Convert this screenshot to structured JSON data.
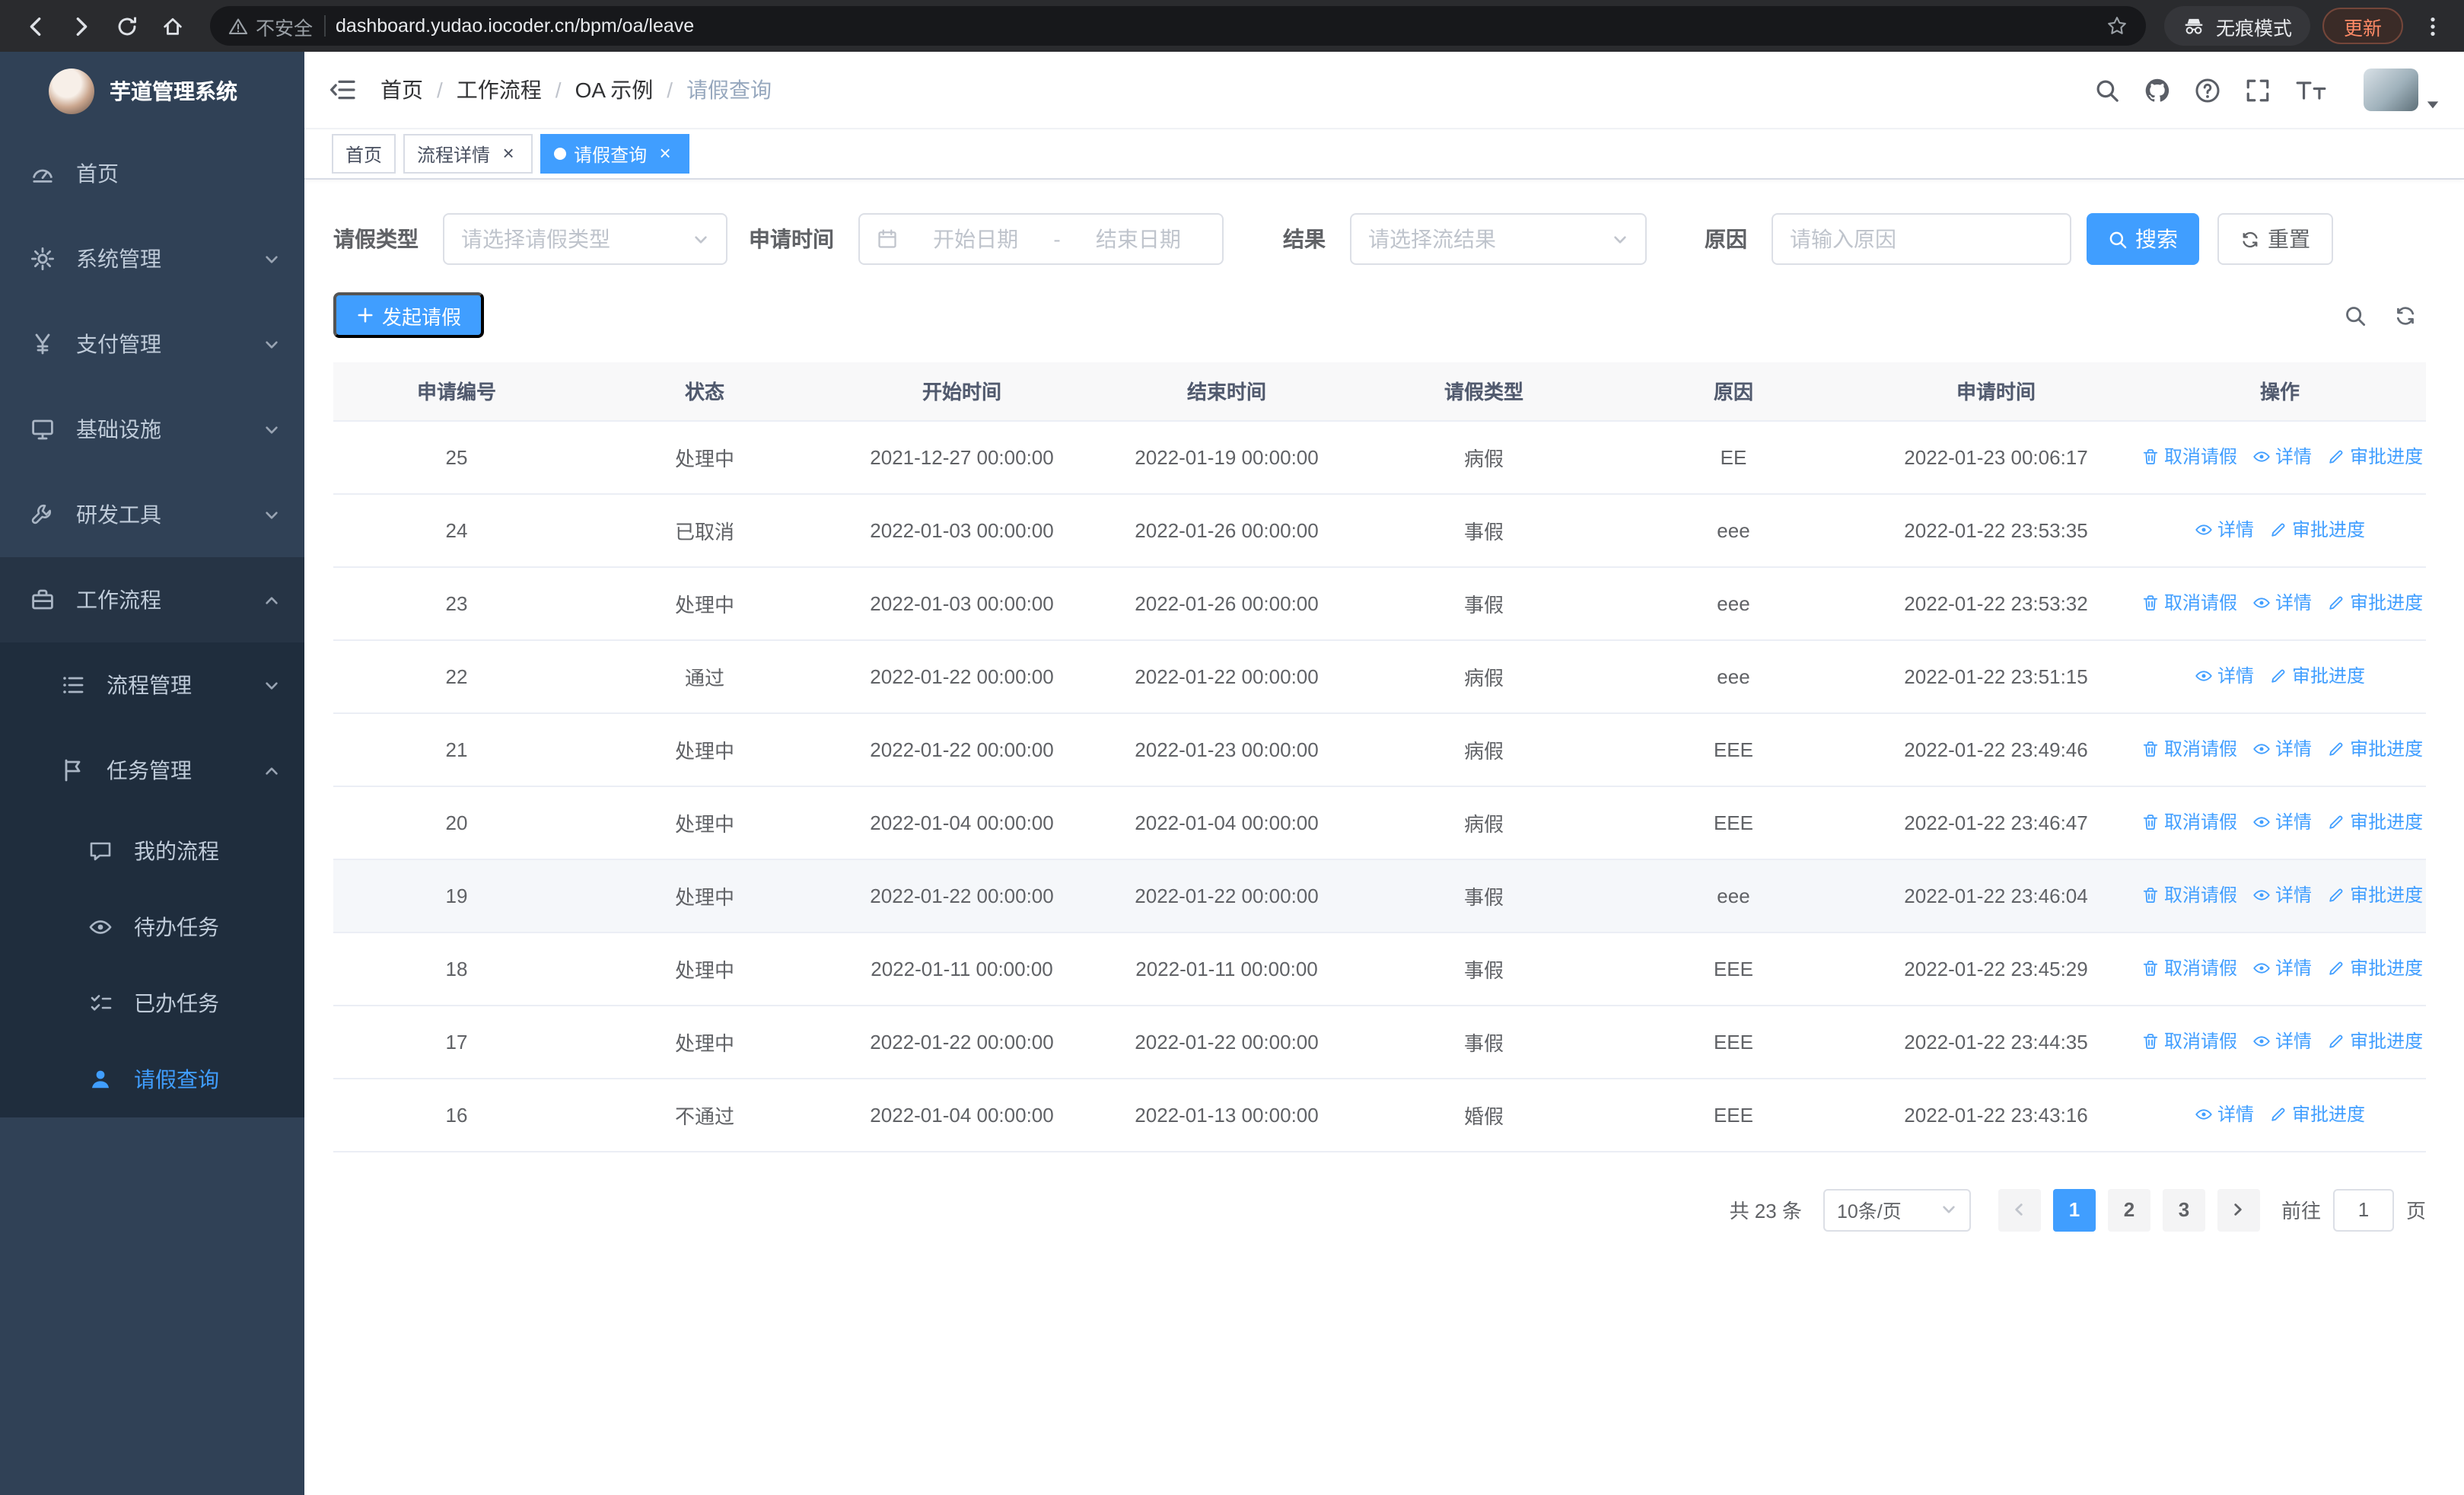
{
  "colors": {
    "primary": "#409eff",
    "sidebar_bg": "#304156",
    "sidebar_submenu_bg": "#1f2d3d"
  },
  "browser": {
    "security_label": "不安全",
    "url": "dashboard.yudao.iocoder.cn/bpm/oa/leave",
    "incognito_label": "无痕模式",
    "update_label": "更新"
  },
  "sidebar": {
    "app_title": "芋道管理系统",
    "menu": [
      {
        "key": "home",
        "label": "首页",
        "icon": "gauge",
        "level": 1
      },
      {
        "key": "system",
        "label": "系统管理",
        "icon": "gear",
        "level": 1,
        "chevron": "down"
      },
      {
        "key": "payment",
        "label": "支付管理",
        "icon": "yen",
        "level": 1,
        "chevron": "down"
      },
      {
        "key": "infrastructure",
        "label": "基础设施",
        "icon": "monitor",
        "level": 1,
        "chevron": "down"
      },
      {
        "key": "dev-tools",
        "label": "研发工具",
        "icon": "wrench",
        "level": 1,
        "chevron": "down"
      },
      {
        "key": "workflow",
        "label": "工作流程",
        "icon": "briefcase",
        "level": 1,
        "chevron": "up",
        "open": true
      },
      {
        "key": "process-management",
        "label": "流程管理",
        "icon": "list",
        "level": 2,
        "chevron": "down",
        "sub": true
      },
      {
        "key": "task-management",
        "label": "任务管理",
        "icon": "flag",
        "level": 2,
        "chevron": "up",
        "sub": true
      },
      {
        "key": "my-process",
        "label": "我的流程",
        "icon": "chat",
        "level": 3,
        "sub": true
      },
      {
        "key": "todo-tasks",
        "label": "待办任务",
        "icon": "eye",
        "level": 3,
        "sub": true
      },
      {
        "key": "done-tasks",
        "label": "已办任务",
        "icon": "check-list",
        "level": 3,
        "sub": true
      },
      {
        "key": "leave-query",
        "label": "请假查询",
        "icon": "user",
        "level": 3,
        "sub": true,
        "active": true
      }
    ]
  },
  "header": {
    "breadcrumb": [
      "首页",
      "工作流程",
      "OA 示例",
      "请假查询"
    ]
  },
  "tabs": [
    {
      "key": "home",
      "label": "首页",
      "closable": false,
      "active": false
    },
    {
      "key": "process-detail",
      "label": "流程详情",
      "closable": true,
      "active": false
    },
    {
      "key": "leave-query",
      "label": "请假查询",
      "closable": true,
      "active": true
    }
  ],
  "filters": {
    "leave_type_label": "请假类型",
    "leave_type_placeholder": "请选择请假类型",
    "apply_time_label": "申请时间",
    "start_date_placeholder": "开始日期",
    "range_separator": "-",
    "end_date_placeholder": "结束日期",
    "result_label": "结果",
    "result_placeholder": "请选择流结果",
    "reason_label": "原因",
    "reason_placeholder": "请输入原因",
    "search_button": "搜索",
    "reset_button": "重置"
  },
  "toolbar": {
    "create_button": "发起请假"
  },
  "table": {
    "columns": [
      "申请编号",
      "状态",
      "开始时间",
      "结束时间",
      "请假类型",
      "原因",
      "申请时间",
      "操作"
    ],
    "action_defs": {
      "cancel": {
        "label": "取消请假",
        "icon": "delete"
      },
      "detail": {
        "label": "详情",
        "icon": "view"
      },
      "progress": {
        "label": "审批进度",
        "icon": "edit"
      }
    },
    "rows": [
      {
        "id": "25",
        "status": "处理中",
        "start": "2021-12-27 00:00:00",
        "end": "2022-01-19 00:00:00",
        "type": "病假",
        "reason": "EE",
        "applied": "2022-01-23 00:06:17",
        "actions": [
          "cancel",
          "detail",
          "progress"
        ]
      },
      {
        "id": "24",
        "status": "已取消",
        "start": "2022-01-03 00:00:00",
        "end": "2022-01-26 00:00:00",
        "type": "事假",
        "reason": "eee",
        "applied": "2022-01-22 23:53:35",
        "actions": [
          "detail",
          "progress"
        ]
      },
      {
        "id": "23",
        "status": "处理中",
        "start": "2022-01-03 00:00:00",
        "end": "2022-01-26 00:00:00",
        "type": "事假",
        "reason": "eee",
        "applied": "2022-01-22 23:53:32",
        "actions": [
          "cancel",
          "detail",
          "progress"
        ]
      },
      {
        "id": "22",
        "status": "通过",
        "start": "2022-01-22 00:00:00",
        "end": "2022-01-22 00:00:00",
        "type": "病假",
        "reason": "eee",
        "applied": "2022-01-22 23:51:15",
        "actions": [
          "detail",
          "progress"
        ]
      },
      {
        "id": "21",
        "status": "处理中",
        "start": "2022-01-22 00:00:00",
        "end": "2022-01-23 00:00:00",
        "type": "病假",
        "reason": "EEE",
        "applied": "2022-01-22 23:49:46",
        "actions": [
          "cancel",
          "detail",
          "progress"
        ]
      },
      {
        "id": "20",
        "status": "处理中",
        "start": "2022-01-04 00:00:00",
        "end": "2022-01-04 00:00:00",
        "type": "病假",
        "reason": "EEE",
        "applied": "2022-01-22 23:46:47",
        "actions": [
          "cancel",
          "detail",
          "progress"
        ]
      },
      {
        "id": "19",
        "status": "处理中",
        "start": "2022-01-22 00:00:00",
        "end": "2022-01-22 00:00:00",
        "type": "事假",
        "reason": "eee",
        "applied": "2022-01-22 23:46:04",
        "actions": [
          "cancel",
          "detail",
          "progress"
        ],
        "highlighted": true
      },
      {
        "id": "18",
        "status": "处理中",
        "start": "2022-01-11 00:00:00",
        "end": "2022-01-11 00:00:00",
        "type": "事假",
        "reason": "EEE",
        "applied": "2022-01-22 23:45:29",
        "actions": [
          "cancel",
          "detail",
          "progress"
        ]
      },
      {
        "id": "17",
        "status": "处理中",
        "start": "2022-01-22 00:00:00",
        "end": "2022-01-22 00:00:00",
        "type": "事假",
        "reason": "EEE",
        "applied": "2022-01-22 23:44:35",
        "actions": [
          "cancel",
          "detail",
          "progress"
        ]
      },
      {
        "id": "16",
        "status": "不通过",
        "start": "2022-01-04 00:00:00",
        "end": "2022-01-13 00:00:00",
        "type": "婚假",
        "reason": "EEE",
        "applied": "2022-01-22 23:43:16",
        "actions": [
          "detail",
          "progress"
        ]
      }
    ]
  },
  "pagination": {
    "total_label": "共 23 条",
    "page_size_label": "10条/页",
    "pages": [
      "1",
      "2",
      "3"
    ],
    "active_page": "1",
    "goto_label": "前往",
    "goto_value": "1",
    "goto_suffix": "页"
  }
}
